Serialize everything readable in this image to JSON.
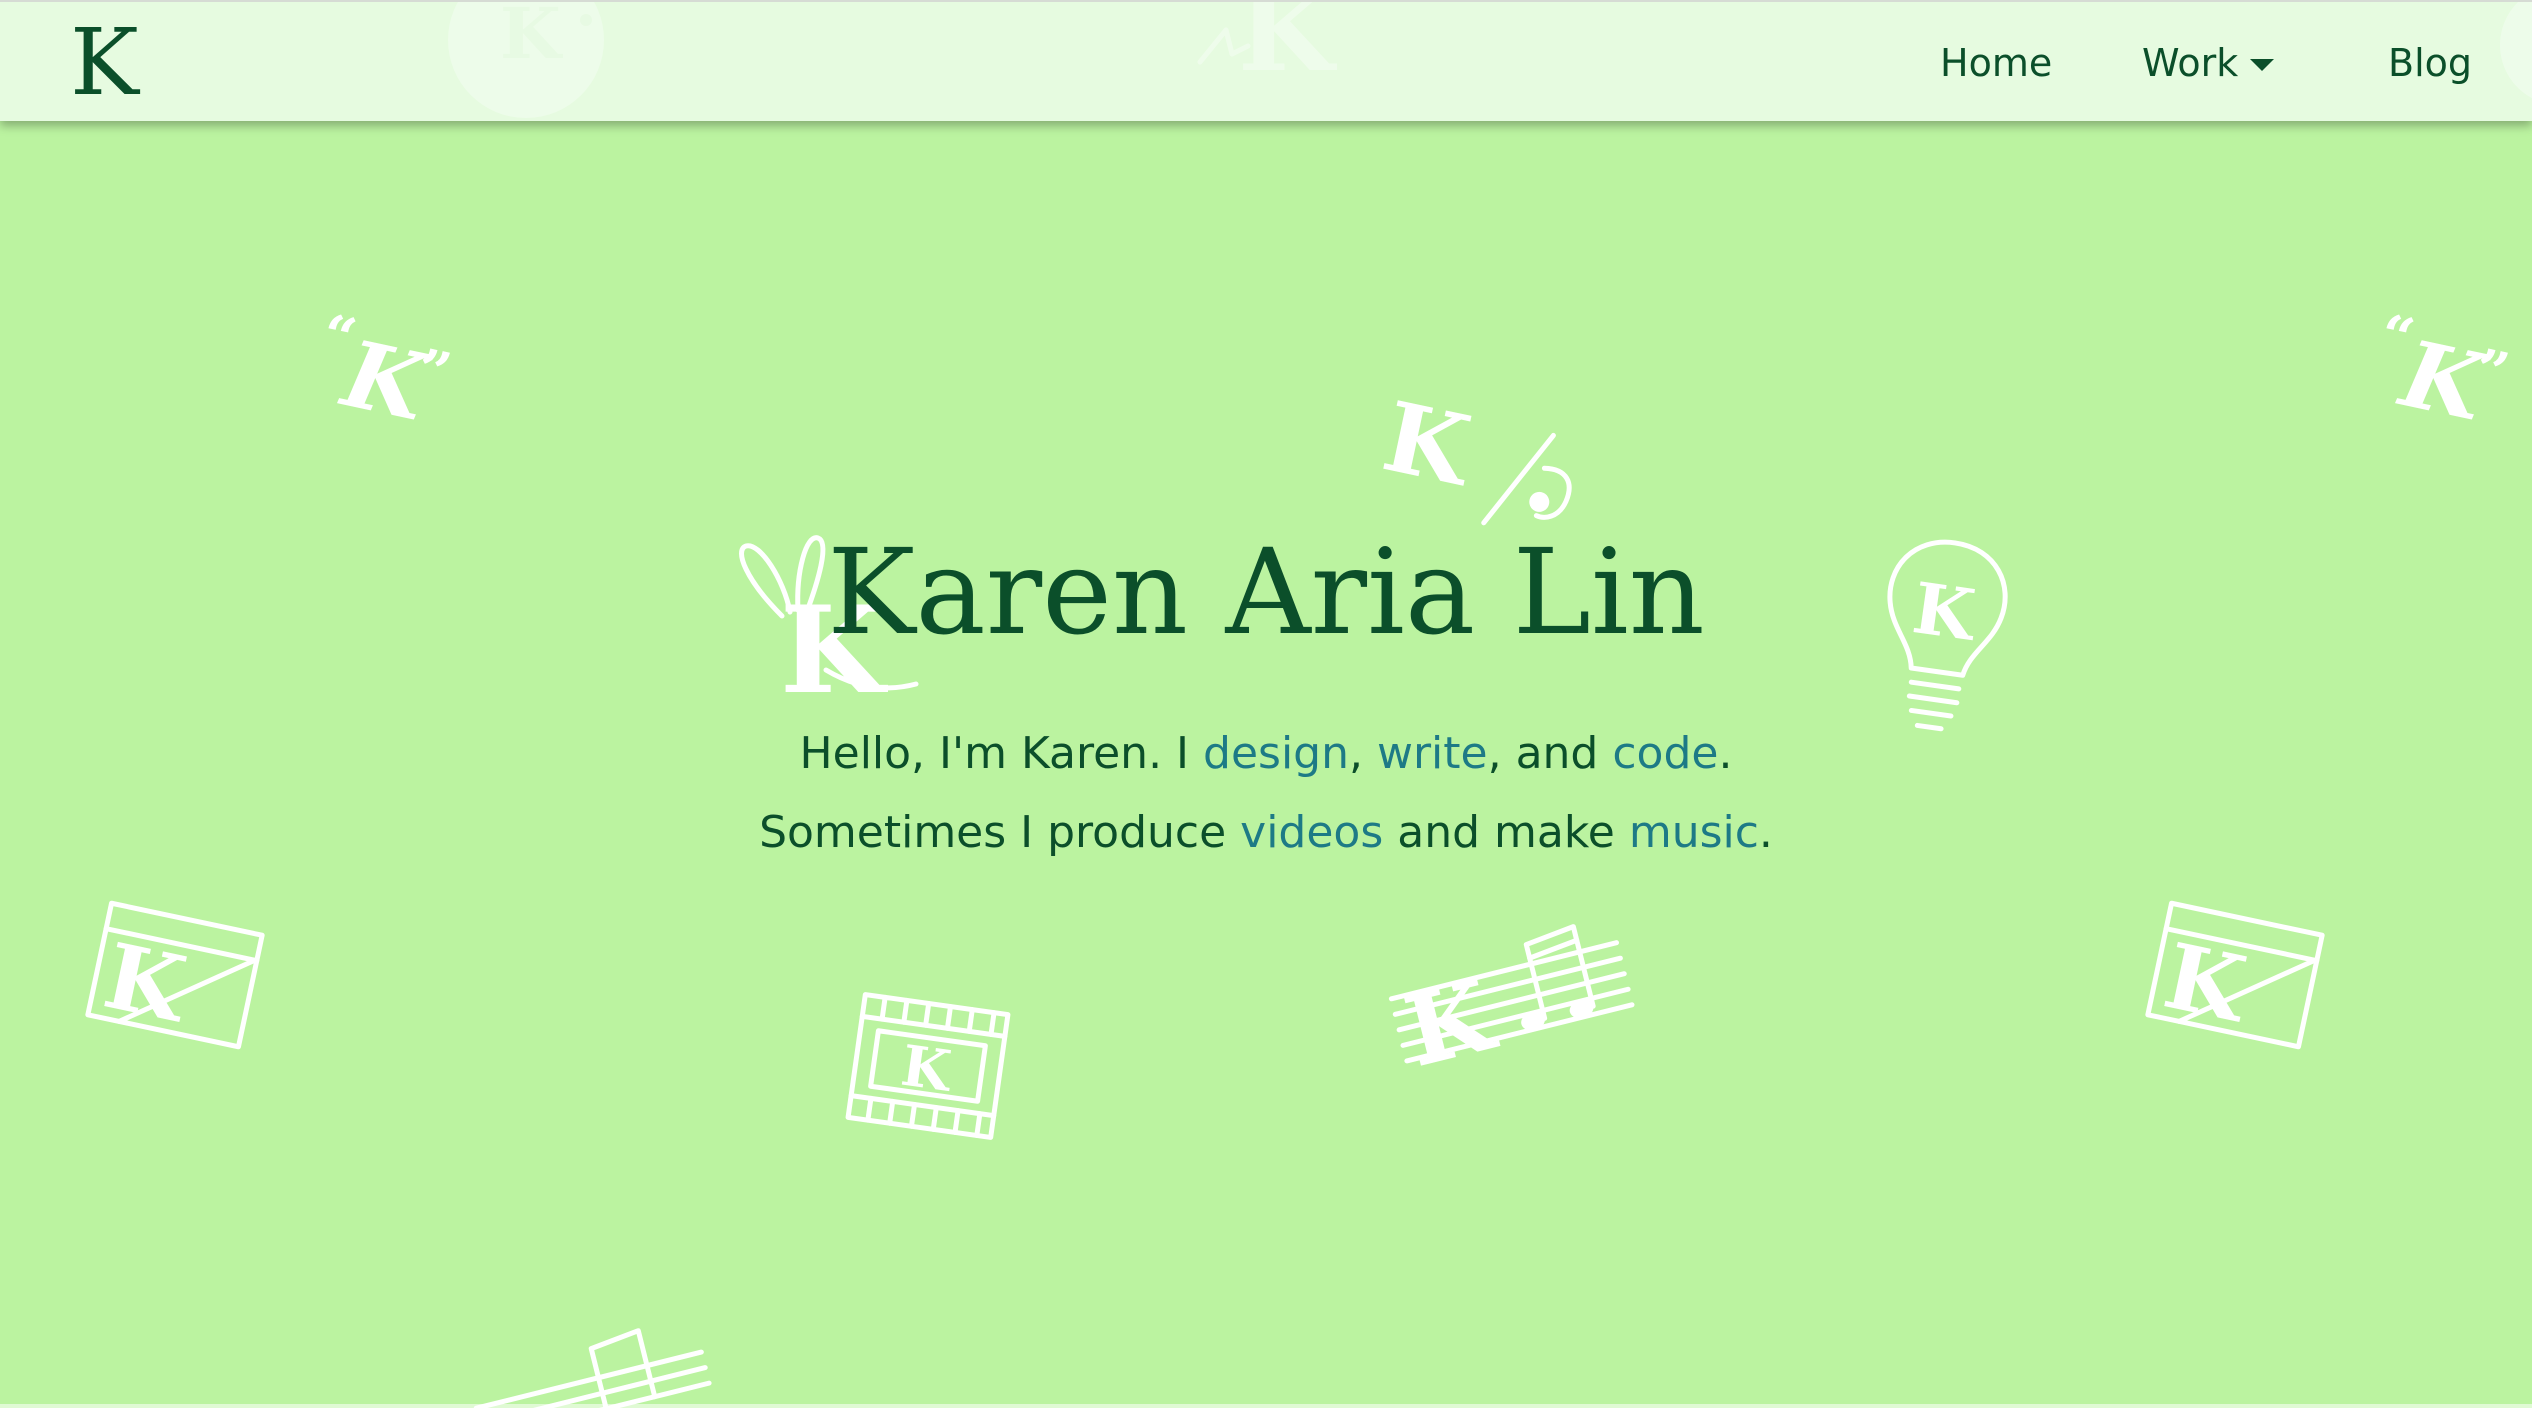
{
  "site": {
    "brand_letter": "K"
  },
  "nav": {
    "home": "Home",
    "work": "Work",
    "blog": "Blog"
  },
  "hero": {
    "title": "Karen Aria Lin",
    "line1": {
      "prefix": "Hello, I'm Karen. I ",
      "link_design": "design",
      "comma1": ", ",
      "link_write": "write",
      "middle": ", and ",
      "link_code": "code",
      "end": "."
    },
    "line2": {
      "prefix": "Sometimes I produce ",
      "link_videos": "videos",
      "middle": " and make ",
      "link_music": "music",
      "end": "."
    }
  },
  "background_icons": {
    "letter": "K",
    "quote_open": "“",
    "quote_close": "”",
    "icons": [
      "quote-k-icon",
      "bunny-k-icon",
      "slash-k-icon",
      "lightbulb-k-icon",
      "photo-k-icon",
      "film-k-icon",
      "music-k-icon",
      "yin-yang-k-icon"
    ]
  },
  "colors": {
    "background": "#bbf3a0",
    "header": "#ecfce8",
    "text": "#0b4f2a",
    "link": "#1d7a86",
    "icon": "#ffffff"
  }
}
